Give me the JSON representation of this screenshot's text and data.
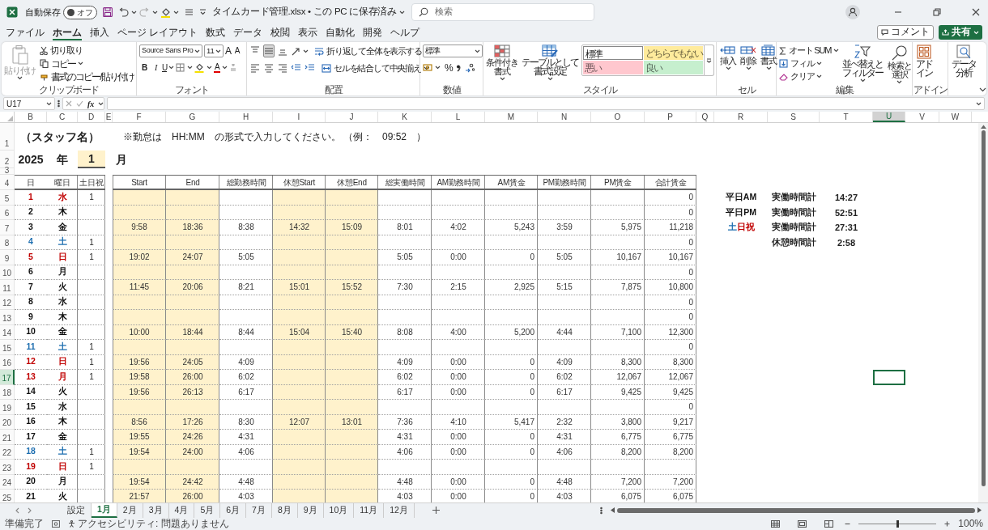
{
  "window": {
    "title": "タイムカード管理.xlsx • この PC に保存済み",
    "autosave_label": "自動保存",
    "autosave": {
      "label": "オフ",
      "on": false
    },
    "search": {
      "placeholder": "検索"
    }
  },
  "menu": [
    {
      "label": "ファイル",
      "selected": false
    },
    {
      "label": "ホーム",
      "selected": true
    },
    {
      "label": "挿入",
      "selected": false
    },
    {
      "label": "ページ レイアウト",
      "selected": false
    },
    {
      "label": "数式",
      "selected": false
    },
    {
      "label": "データ",
      "selected": false
    },
    {
      "label": "校閲",
      "selected": false
    },
    {
      "label": "表示",
      "selected": false
    },
    {
      "label": "自動化",
      "selected": false
    },
    {
      "label": "開発",
      "selected": false
    },
    {
      "label": "ヘルプ",
      "selected": false
    }
  ],
  "comment_button": "コメント",
  "share_button": "共有",
  "ribbon": {
    "clipboard": {
      "paste": {
        "label": "貼り付け",
        "disabled": true
      },
      "cut": "切り取り",
      "copy": "コピー",
      "format_painter": "書式のコピー/貼り付け",
      "group": "クリップボード"
    },
    "font": {
      "name": "Source Sans Pro",
      "size": "11",
      "grow": "A",
      "shrink": "A",
      "bold": "B",
      "italic": "I",
      "underline": "U",
      "color_letter": "A",
      "group": "フォント"
    },
    "alignment": {
      "vertical": [
        {
          "selected": false
        },
        {
          "selected": true
        },
        {
          "selected": false
        }
      ],
      "wrap": "折り返して全体を表示する",
      "merge": "セルを結合して中央揃え",
      "group": "配置"
    },
    "number": {
      "format": "標準",
      "percent": "%",
      "group": "数値"
    },
    "styles": {
      "conditional": "条件付き書式",
      "table": "テーブルとして書式設定",
      "cells": [
        {
          "label": "標準",
          "color": "#ffffff"
        },
        {
          "label": "どちらでもない",
          "color": "#ffeb9c"
        },
        {
          "label": "悪い",
          "color": "#ffc7ce"
        },
        {
          "label": "良い",
          "color": "#c6efce"
        }
      ],
      "group": "スタイル"
    },
    "cells": {
      "buttons": [
        "挿入",
        "削除",
        "書式"
      ],
      "group": "セル"
    },
    "editing": {
      "autosum": "オート SUM",
      "fill": "フィル",
      "clear": "クリア",
      "sort": "並べ替えとフィルター",
      "find": "検索と選択",
      "group": "編集"
    },
    "addins": {
      "addin": "アドイン",
      "analysis": "データ分析",
      "group": "アドイン"
    }
  },
  "formula_bar": {
    "name_box": "U17",
    "fx": "fx"
  },
  "column_headers": [
    {
      "label": "B",
      "selected": false
    },
    {
      "label": "C",
      "selected": false
    },
    {
      "label": "D",
      "selected": false
    },
    {
      "label": "E",
      "selected": false
    },
    {
      "label": "F",
      "selected": false
    },
    {
      "label": "G",
      "selected": false
    },
    {
      "label": "H",
      "selected": false
    },
    {
      "label": "I",
      "selected": false
    },
    {
      "label": "J",
      "selected": false
    },
    {
      "label": "K",
      "selected": false
    },
    {
      "label": "L",
      "selected": false
    },
    {
      "label": "M",
      "selected": false
    },
    {
      "label": "N",
      "selected": false
    },
    {
      "label": "O",
      "selected": false
    },
    {
      "label": "P",
      "selected": false
    },
    {
      "label": "Q",
      "selected": false
    },
    {
      "label": "R",
      "selected": false
    },
    {
      "label": "S",
      "selected": false
    },
    {
      "label": "T",
      "selected": false
    },
    {
      "label": "U",
      "selected": true
    },
    {
      "label": "V",
      "selected": false
    },
    {
      "label": "W",
      "selected": false
    }
  ],
  "row_headers": [
    {
      "label": "1",
      "selected": false
    },
    {
      "label": "2",
      "selected": false
    },
    {
      "label": "3",
      "selected": false
    },
    {
      "label": "4",
      "selected": false
    },
    {
      "label": "5",
      "selected": false
    },
    {
      "label": "6",
      "selected": false
    },
    {
      "label": "7",
      "selected": false
    },
    {
      "label": "8",
      "selected": false
    },
    {
      "label": "9",
      "selected": false
    },
    {
      "label": "10",
      "selected": false
    },
    {
      "label": "11",
      "selected": false
    },
    {
      "label": "12",
      "selected": false
    },
    {
      "label": "13",
      "selected": false
    },
    {
      "label": "14",
      "selected": false
    },
    {
      "label": "15",
      "selected": false
    },
    {
      "label": "16",
      "selected": false
    },
    {
      "label": "17",
      "selected": true
    },
    {
      "label": "18",
      "selected": false
    },
    {
      "label": "19",
      "selected": false
    },
    {
      "label": "20",
      "selected": false
    },
    {
      "label": "21",
      "selected": false
    },
    {
      "label": "22",
      "selected": false
    },
    {
      "label": "23",
      "selected": false
    },
    {
      "label": "24",
      "selected": false
    },
    {
      "label": "25",
      "selected": false
    }
  ],
  "sheet": {
    "staff": "（スタッフ名）",
    "note": "※勤怠は　HH:MM　の形式で入力してください。 （例：　09:52　）",
    "year": "2025",
    "year_unit": "年",
    "month": "1",
    "month_unit": "月",
    "columns": [
      "日",
      "曜日",
      "土日祝",
      "Start",
      "End",
      "総勤務時間",
      "休憩Start",
      "休憩End",
      "総実働時間",
      "AM勤務時間",
      "AM賃金",
      "PM勤務時間",
      "PM賃金",
      "合計賃金"
    ],
    "rows": [
      {
        "day": "1",
        "weekday": "水",
        "kind": "holiday",
        "flag": "1",
        "total_pay": "0"
      },
      {
        "day": "2",
        "weekday": "木",
        "kind": "weekday",
        "total_pay": "0"
      },
      {
        "day": "3",
        "weekday": "金",
        "kind": "weekday",
        "start": "9:58",
        "end": "18:36",
        "total": "8:38",
        "break_start": "14:32",
        "break_end": "15:09",
        "actual": "8:01",
        "am_hours": "4:02",
        "am_pay": "5,243",
        "pm_hours": "3:59",
        "pm_pay": "5,975",
        "total_pay": "11,218"
      },
      {
        "day": "4",
        "weekday": "土",
        "kind": "saturday",
        "flag": "1",
        "total_pay": "0"
      },
      {
        "day": "5",
        "weekday": "日",
        "kind": "holiday",
        "flag": "1",
        "start": "19:02",
        "end": "24:07",
        "total": "5:05",
        "actual": "5:05",
        "am_hours": "0:00",
        "am_pay": "0",
        "pm_hours": "5:05",
        "pm_pay": "10,167",
        "total_pay": "10,167"
      },
      {
        "day": "6",
        "weekday": "月",
        "kind": "weekday",
        "total_pay": "0"
      },
      {
        "day": "7",
        "weekday": "火",
        "kind": "weekday",
        "start": "11:45",
        "end": "20:06",
        "total": "8:21",
        "break_start": "15:01",
        "break_end": "15:52",
        "actual": "7:30",
        "am_hours": "2:15",
        "am_pay": "2,925",
        "pm_hours": "5:15",
        "pm_pay": "7,875",
        "total_pay": "10,800"
      },
      {
        "day": "8",
        "weekday": "水",
        "kind": "weekday",
        "total_pay": "0"
      },
      {
        "day": "9",
        "weekday": "木",
        "kind": "weekday",
        "total_pay": "0"
      },
      {
        "day": "10",
        "weekday": "金",
        "kind": "weekday",
        "start": "10:00",
        "end": "18:44",
        "total": "8:44",
        "break_start": "15:04",
        "break_end": "15:40",
        "actual": "8:08",
        "am_hours": "4:00",
        "am_pay": "5,200",
        "pm_hours": "4:44",
        "pm_pay": "7,100",
        "total_pay": "12,300"
      },
      {
        "day": "11",
        "weekday": "土",
        "kind": "saturday",
        "flag": "1",
        "total_pay": "0"
      },
      {
        "day": "12",
        "weekday": "日",
        "kind": "holiday",
        "flag": "1",
        "start": "19:56",
        "end": "24:05",
        "total": "4:09",
        "actual": "4:09",
        "am_hours": "0:00",
        "am_pay": "0",
        "pm_hours": "4:09",
        "pm_pay": "8,300",
        "total_pay": "8,300"
      },
      {
        "day": "13",
        "weekday": "月",
        "kind": "holiday",
        "flag": "1",
        "start": "19:58",
        "end": "26:00",
        "total": "6:02",
        "actual": "6:02",
        "am_hours": "0:00",
        "am_pay": "0",
        "pm_hours": "6:02",
        "pm_pay": "12,067",
        "total_pay": "12,067"
      },
      {
        "day": "14",
        "weekday": "火",
        "kind": "weekday",
        "start": "19:56",
        "end": "26:13",
        "total": "6:17",
        "actual": "6:17",
        "am_hours": "0:00",
        "am_pay": "0",
        "pm_hours": "6:17",
        "pm_pay": "9,425",
        "total_pay": "9,425"
      },
      {
        "day": "15",
        "weekday": "水",
        "kind": "weekday",
        "total_pay": "0"
      },
      {
        "day": "16",
        "weekday": "木",
        "kind": "weekday",
        "start": "8:56",
        "end": "17:26",
        "total": "8:30",
        "break_start": "12:07",
        "break_end": "13:01",
        "actual": "7:36",
        "am_hours": "4:10",
        "am_pay": "5,417",
        "pm_hours": "2:32",
        "pm_pay": "3,800",
        "total_pay": "9,217"
      },
      {
        "day": "17",
        "weekday": "金",
        "kind": "weekday",
        "start": "19:55",
        "end": "24:26",
        "total": "4:31",
        "actual": "4:31",
        "am_hours": "0:00",
        "am_pay": "0",
        "pm_hours": "4:31",
        "pm_pay": "6,775",
        "total_pay": "6,775"
      },
      {
        "day": "18",
        "weekday": "土",
        "kind": "saturday",
        "flag": "1",
        "start": "19:54",
        "end": "24:00",
        "total": "4:06",
        "actual": "4:06",
        "am_hours": "0:00",
        "am_pay": "0",
        "pm_hours": "4:06",
        "pm_pay": "8,200",
        "total_pay": "8,200"
      },
      {
        "day": "19",
        "weekday": "日",
        "kind": "holiday",
        "flag": "1"
      },
      {
        "day": "20",
        "weekday": "月",
        "kind": "weekday",
        "start": "19:54",
        "end": "24:42",
        "total": "4:48",
        "actual": "4:48",
        "am_hours": "0:00",
        "am_pay": "0",
        "pm_hours": "4:48",
        "pm_pay": "7,200",
        "total_pay": "7,200"
      },
      {
        "day": "21",
        "weekday": "火",
        "kind": "weekday",
        "start": "21:57",
        "end": "26:00",
        "total": "4:03",
        "actual": "4:03",
        "am_hours": "0:00",
        "am_pay": "0",
        "pm_hours": "4:03",
        "pm_pay": "6,075",
        "total_pay": "6,075"
      }
    ],
    "summary": [
      {
        "category": [
          {
            "text": "平日AM",
            "kind": "plain"
          }
        ],
        "label": "実働時間計",
        "value": "14:27"
      },
      {
        "category": [
          {
            "text": "平日PM",
            "kind": "plain"
          }
        ],
        "label": "実働時間計",
        "value": "52:51"
      },
      {
        "category": [
          {
            "text": "土",
            "kind": "saturday"
          },
          {
            "text": "日祝",
            "kind": "holiday"
          }
        ],
        "label": "実働時間計",
        "value": "27:31"
      },
      {
        "label": "休憩時間計",
        "value": "2:58"
      }
    ]
  },
  "sheet_tabs": [
    {
      "label": "設定",
      "selected": false
    },
    {
      "label": "1月",
      "selected": true
    },
    {
      "label": "2月",
      "selected": false
    },
    {
      "label": "3月",
      "selected": false
    },
    {
      "label": "4月",
      "selected": false
    },
    {
      "label": "5月",
      "selected": false
    },
    {
      "label": "6月",
      "selected": false
    },
    {
      "label": "7月",
      "selected": false
    },
    {
      "label": "8月",
      "selected": false
    },
    {
      "label": "9月",
      "selected": false
    },
    {
      "label": "10月",
      "selected": false
    },
    {
      "label": "11月",
      "selected": false
    },
    {
      "label": "12月",
      "selected": false
    }
  ],
  "status": {
    "ready": "準備完了",
    "accessibility": "アクセシビリティ: 問題ありません",
    "zoom": {
      "label": "100%",
      "level": 0.5
    }
  }
}
